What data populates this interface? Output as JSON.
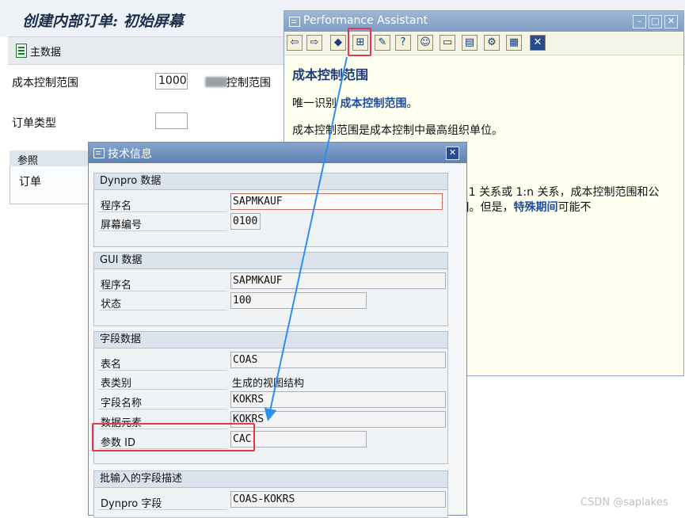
{
  "main": {
    "title": "创建内部订单: 初始屏幕",
    "toolbar_main_data": "主数据",
    "co_area_label": "成本控制范围",
    "co_area_value": "1000",
    "co_area_text": "控制范围",
    "order_type_label": "订单类型",
    "order_type_value": "",
    "reference_group": "参照",
    "order_label": "订单"
  },
  "assistant": {
    "title": "Performance Assistant",
    "heading": "成本控制范围",
    "p1_text": "唯一识别 ",
    "p1_link": "成本控制范围",
    "p1_end": "。",
    "p2": "成本控制范围是成本控制中最高组织单位。",
    "p3": ":1 关系或 1:n 关系，成本控制范围和公",
    "p4_text": "]。但是，",
    "p4_link": "特殊期间",
    "p4_end": "可能不"
  },
  "tech": {
    "title": "技术信息",
    "dynpro": {
      "header": "Dynpro 数据",
      "prog_label": "程序名",
      "prog_value": "SAPMKAUF",
      "screen_label": "屏幕编号",
      "screen_value": "0100"
    },
    "gui": {
      "header": "GUI 数据",
      "prog_label": "程序名",
      "prog_value": "SAPMKAUF",
      "status_label": "状态",
      "status_value": "100"
    },
    "field": {
      "header": "字段数据",
      "table_label": "表名",
      "table_value": "COAS",
      "table_type_label": "表类别",
      "table_type_value": "生成的视图结构",
      "field_label": "字段名称",
      "field_value": "KOKRS",
      "element_label": "数据元素",
      "element_value": "KOKRS",
      "param_label": "参数 ID",
      "param_value": "CAC"
    },
    "batch": {
      "header": "批输入的字段描述",
      "dynpro_field_label": "Dynpro 字段",
      "dynpro_field_value": "COAS-KOKRS"
    }
  },
  "watermark": "CSDN @saplakes",
  "colors": {
    "highlight": "#e03a4a",
    "arrow": "#2a8ff0",
    "link": "#1e4e9c"
  },
  "icons": [
    "back-icon",
    "forward-icon",
    "book-icon",
    "technical-info-icon",
    "edit-icon",
    "help-icon",
    "users-icon",
    "link-icon",
    "print-icon",
    "settings-icon",
    "window-icon",
    "close-icon"
  ]
}
